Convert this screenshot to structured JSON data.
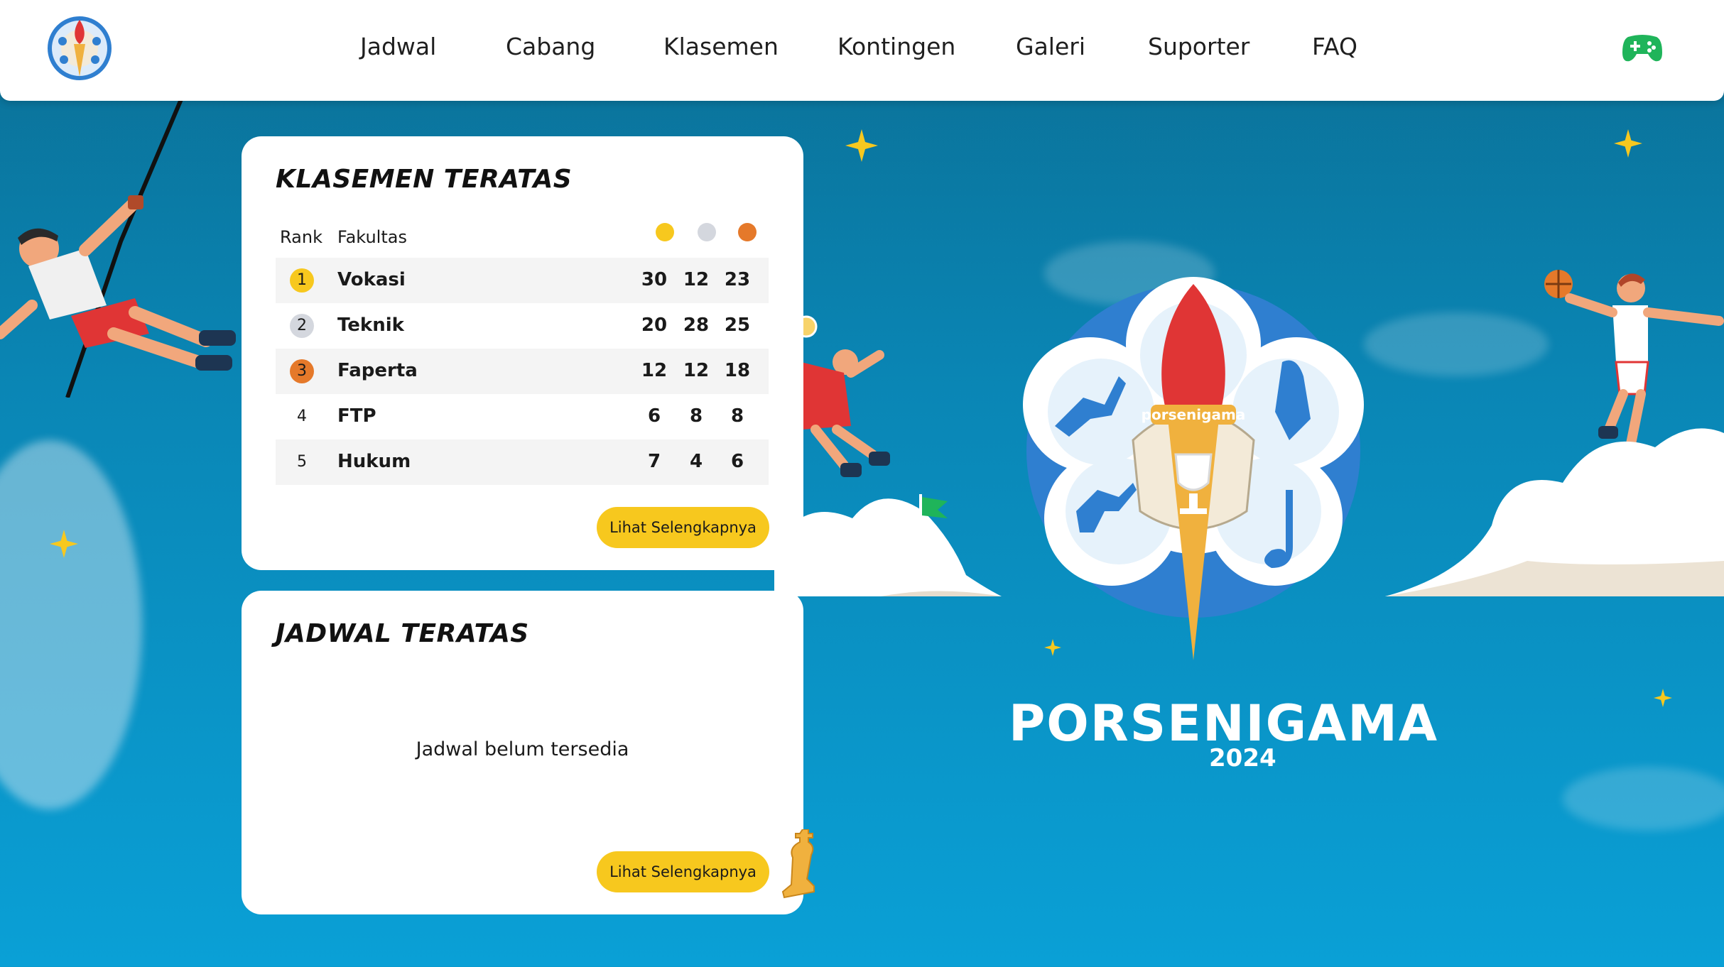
{
  "nav": {
    "items": [
      "Jadwal",
      "Cabang",
      "Klasemen",
      "Kontingen",
      "Galeri",
      "Suporter",
      "FAQ"
    ]
  },
  "icons": {
    "logo": "porsenigama-logo-icon",
    "gamepad": "gamepad-icon"
  },
  "colors": {
    "gold": "#f7c81e",
    "silver": "#d4d7de",
    "bronze": "#e5792a",
    "accent_green": "#1fb45a"
  },
  "standings": {
    "title": "KLASEMEN TERATAS",
    "col_rank": "Rank",
    "col_faculty": "Fakultas",
    "rows": [
      {
        "rank": "1",
        "faculty": "Vokasi",
        "gold": "30",
        "silver": "12",
        "bronze": "23"
      },
      {
        "rank": "2",
        "faculty": "Teknik",
        "gold": "20",
        "silver": "28",
        "bronze": "25"
      },
      {
        "rank": "3",
        "faculty": "Faperta",
        "gold": "12",
        "silver": "12",
        "bronze": "18"
      },
      {
        "rank": "4",
        "faculty": "FTP",
        "gold": "6",
        "silver": "8",
        "bronze": "8"
      },
      {
        "rank": "5",
        "faculty": "Hukum",
        "gold": "7",
        "silver": "4",
        "bronze": "6"
      }
    ],
    "more_label": "Lihat Selengkapnya"
  },
  "schedule": {
    "title": "JADWAL TERATAS",
    "empty_text": "Jadwal belum tersedia",
    "more_label": "Lihat Selengkapnya"
  },
  "brand": {
    "emblem_text": "porsenigama",
    "name": "PORSENIGAMA",
    "year": "2024"
  }
}
